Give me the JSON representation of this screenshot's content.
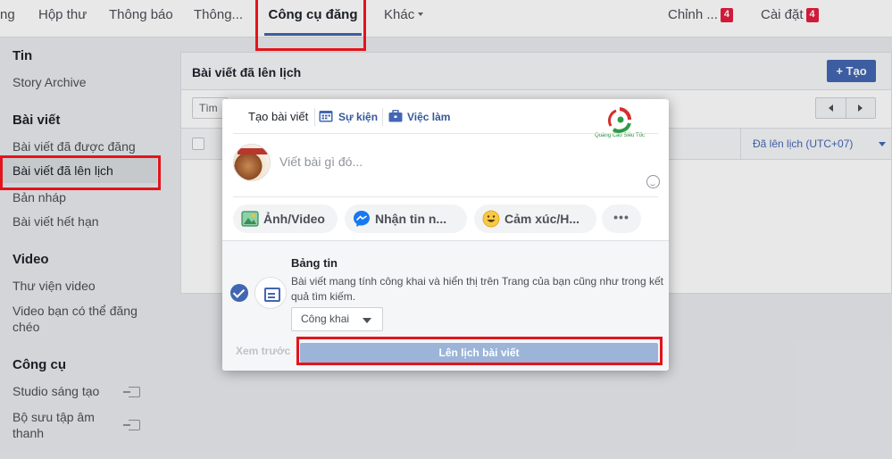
{
  "topnav": {
    "tabs": [
      {
        "label": "ng"
      },
      {
        "label": "Hộp thư"
      },
      {
        "label": "Thông báo"
      },
      {
        "label": "Thông..."
      },
      {
        "label": "Công cụ đăng"
      },
      {
        "label": "Khác"
      }
    ],
    "edit": {
      "label": "Chỉnh ...",
      "badge": "4"
    },
    "settings": {
      "label": "Cài đặt",
      "badge": "4"
    }
  },
  "sidebar": {
    "tin_heading": "Tin",
    "story_archive": "Story Archive",
    "posts_heading": "Bài viết",
    "published": "Bài viết đã được đăng",
    "scheduled": "Bài viết đã lên lịch",
    "drafts": "Bản nháp",
    "expired": "Bài viết hết hạn",
    "video_heading": "Video",
    "video_library": "Thư viện video",
    "crosspost_line1": "Video bạn có thể đăng",
    "crosspost_line2": "chéo",
    "tools_heading": "Công cụ",
    "creator_studio": "Studio sáng tạo",
    "sound_line1": "Bộ sưu tập âm",
    "sound_line2": "thanh"
  },
  "panel": {
    "title": "Bài viết đã lên lịch",
    "create_button": "+ Tạo",
    "search_partial": "Tìm",
    "column_scheduled": "Đã lên lịch (UTC+07)"
  },
  "composer": {
    "tab_create": "Tạo bài viết",
    "tab_event": "Sự kiện",
    "tab_job": "Việc làm",
    "logo_text": "Quảng Cáo Siêu Tốc",
    "placeholder": "Viết bài gì đó...",
    "photo_video": "Ảnh/Video",
    "get_messages": "Nhận tin n...",
    "feeling": "Cảm xúc/H...",
    "more": "•••",
    "audience_title": "Bảng tin",
    "audience_desc": "Bài viết mang tính công khai và hiển thị trên Trang của bạn cũng như trong kết quả tìm kiếm.",
    "privacy": "Công khai",
    "preview": "Xem trước",
    "schedule_button": "Lên lịch bài viết"
  },
  "colors": {
    "facebook_blue": "#4267b2",
    "highlight_red": "#e3141b",
    "schedule_button_disabled": "#9cb4d8"
  }
}
